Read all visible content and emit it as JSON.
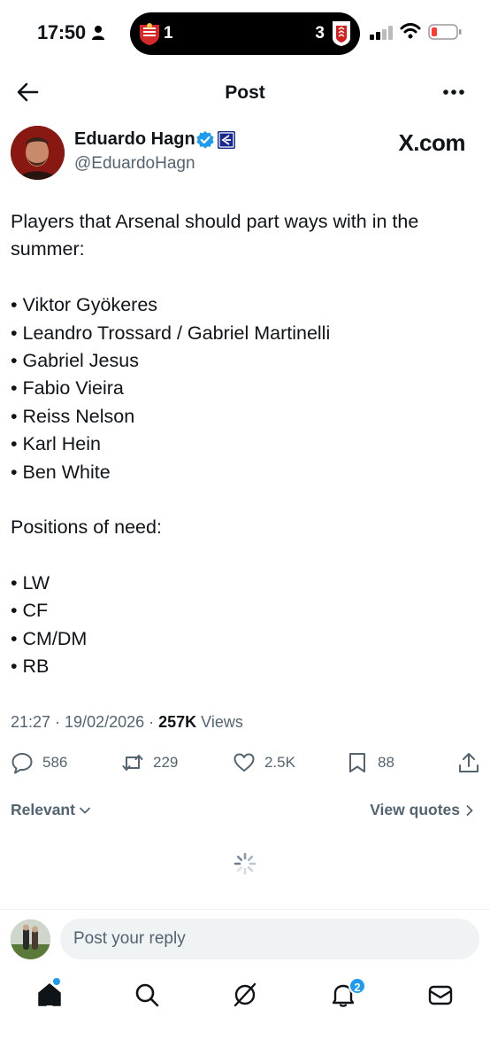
{
  "status_bar": {
    "time": "17:50",
    "score_left": "1",
    "score_right": "3"
  },
  "header": {
    "title": "Post"
  },
  "author": {
    "name": "Eduardo Hagn",
    "handle": "@EduardoHagn",
    "source_badge": "X.com"
  },
  "post": {
    "lines": [
      "Players that Arsenal should part ways with in the",
      "summer:",
      "",
      "• Viktor Gyökeres",
      "• Leandro Trossard / Gabriel Martinelli",
      "• Gabriel Jesus",
      "• Fabio Vieira",
      "• Reiss Nelson",
      "• Karl Hein",
      "• Ben White",
      "",
      "Positions of need:",
      "",
      "• LW",
      "• CF",
      "• CM/DM",
      "• RB"
    ]
  },
  "meta": {
    "timestamp": "21:27 · 19/02/2026 · ",
    "views_count": "257K",
    "views_label": " Views"
  },
  "actions": {
    "replies": "586",
    "reposts": "229",
    "likes": "2.5K",
    "bookmarks": "88"
  },
  "sort": {
    "relevant_label": "Relevant",
    "view_quotes_label": "View quotes"
  },
  "reply": {
    "placeholder": "Post your reply"
  },
  "tabbar": {
    "notifications_badge": "2"
  },
  "colors": {
    "accent": "#1d9bf0",
    "text": "#0f1419",
    "secondary": "#536471"
  }
}
